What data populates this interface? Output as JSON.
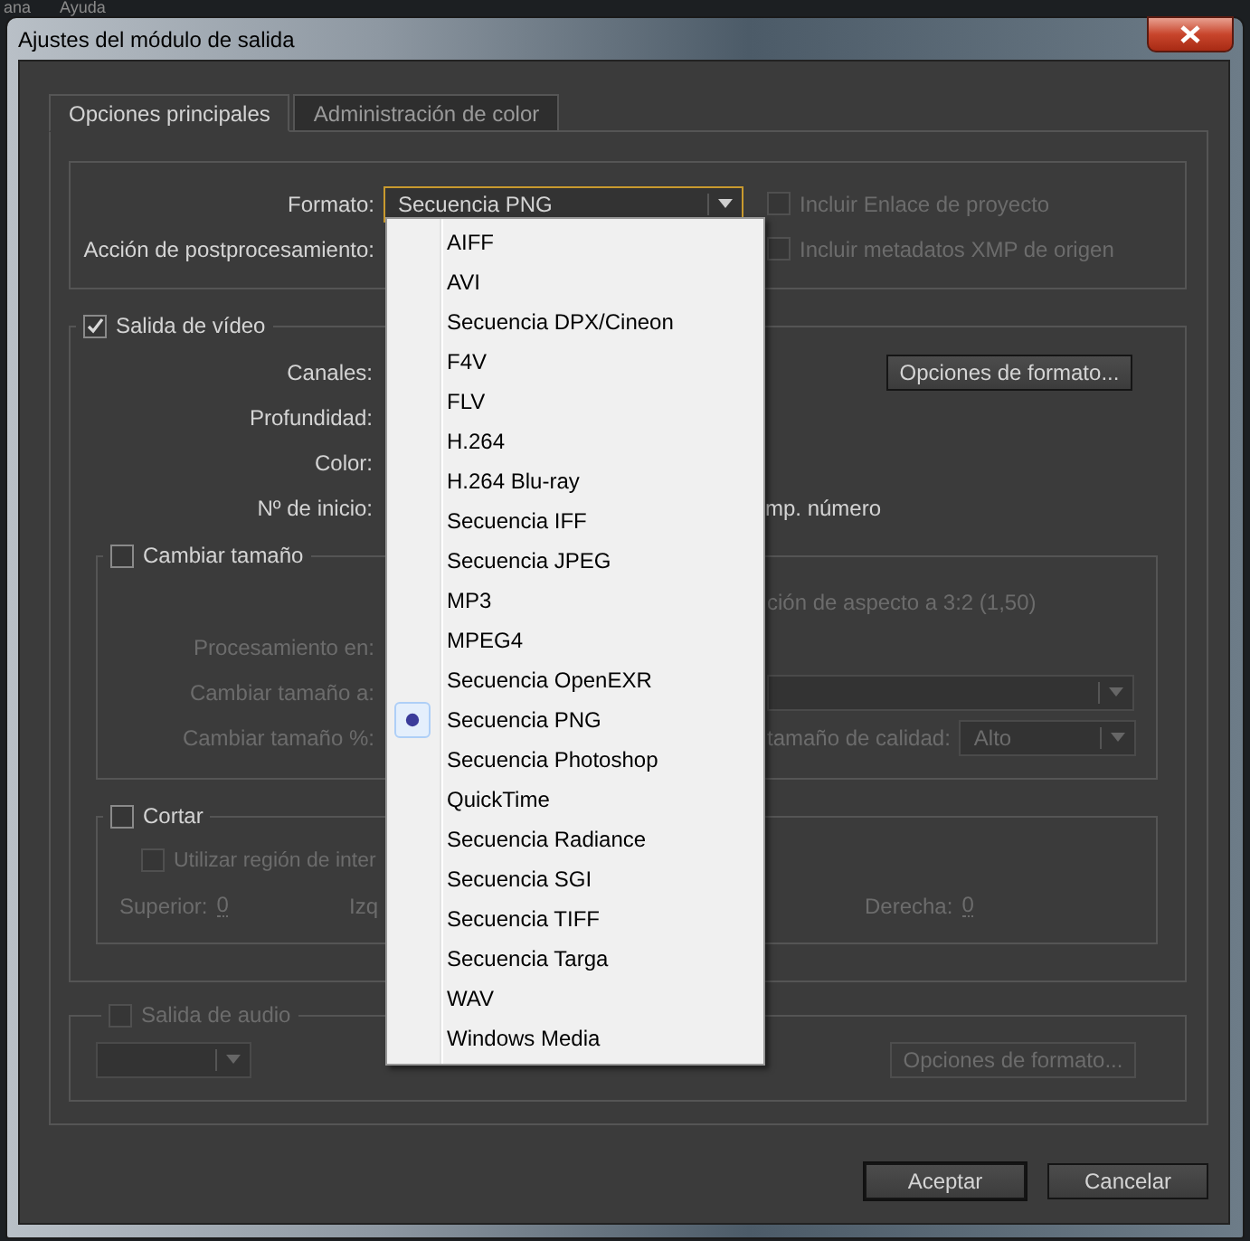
{
  "background_menu": [
    {
      "label": "ana"
    },
    {
      "label": "Ayuda"
    }
  ],
  "window": {
    "title": "Ajustes del módulo de salida"
  },
  "tabs": [
    {
      "label": "Opciones principales",
      "selected": true
    },
    {
      "label": "Administración de color",
      "selected": false
    }
  ],
  "output": {
    "format_label": "Formato:",
    "format_value": "Secuencia PNG",
    "post_label": "Acción de postprocesamiento:",
    "options": [
      {
        "label": "Incluir Enlace de proyecto",
        "checked": false,
        "disabled": true
      },
      {
        "label": "Incluir metadatos XMP de origen",
        "checked": false,
        "disabled": true
      }
    ]
  },
  "video": {
    "label": "Salida de vídeo",
    "checked": true,
    "format_button": "Opciones de formato...",
    "rows": [
      {
        "label": "Canales:"
      },
      {
        "label": "Profundidad:"
      },
      {
        "label": "Color:"
      },
      {
        "label": "Nº de inicio:",
        "trailing": "mp. número"
      }
    ],
    "resize": {
      "label": "Cambiar tamaño",
      "checked": false,
      "aspect_note": "ción de aspecto a 3:2 (1,50)",
      "rows": [
        {
          "label": "Procesamiento en:",
          "kind": "text"
        },
        {
          "label": "Cambiar tamaño a:",
          "kind": "select"
        },
        {
          "label": "Cambiar tamaño %:",
          "kind": "quality",
          "quality_label": "tamaño de calidad:",
          "quality_value": "Alto"
        }
      ]
    },
    "crop": {
      "label": "Cortar",
      "checked": false,
      "roi": {
        "label": "Utilizar región de inter",
        "checked": false
      },
      "fields": [
        {
          "label": "Superior:",
          "value": "0"
        },
        {
          "label": "Izq"
        },
        {
          "label": "Derecha:",
          "value": "0"
        }
      ]
    }
  },
  "audio": {
    "label": "Salida de audio",
    "checked": false,
    "disabled": true,
    "format_button": "Opciones de formato..."
  },
  "buttons": [
    {
      "label": "Aceptar",
      "kind": "default"
    },
    {
      "label": "Cancelar",
      "kind": "normal"
    }
  ],
  "format_menu": {
    "items": [
      {
        "label": "AIFF",
        "selected": false
      },
      {
        "label": "AVI",
        "selected": false
      },
      {
        "label": "Secuencia DPX/Cineon",
        "selected": false
      },
      {
        "label": "F4V",
        "selected": false
      },
      {
        "label": "FLV",
        "selected": false
      },
      {
        "label": "H.264",
        "selected": false
      },
      {
        "label": "H.264 Blu-ray",
        "selected": false
      },
      {
        "label": "Secuencia IFF",
        "selected": false
      },
      {
        "label": "Secuencia JPEG",
        "selected": false
      },
      {
        "label": "MP3",
        "selected": false
      },
      {
        "label": "MPEG4",
        "selected": false
      },
      {
        "label": "Secuencia OpenEXR",
        "selected": false
      },
      {
        "label": "Secuencia PNG",
        "selected": true
      },
      {
        "label": "Secuencia Photoshop",
        "selected": false
      },
      {
        "label": "QuickTime",
        "selected": false
      },
      {
        "label": "Secuencia Radiance",
        "selected": false
      },
      {
        "label": "Secuencia SGI",
        "selected": false
      },
      {
        "label": "Secuencia TIFF",
        "selected": false
      },
      {
        "label": "Secuencia Targa",
        "selected": false
      },
      {
        "label": "WAV",
        "selected": false
      },
      {
        "label": "Windows Media",
        "selected": false
      }
    ]
  }
}
